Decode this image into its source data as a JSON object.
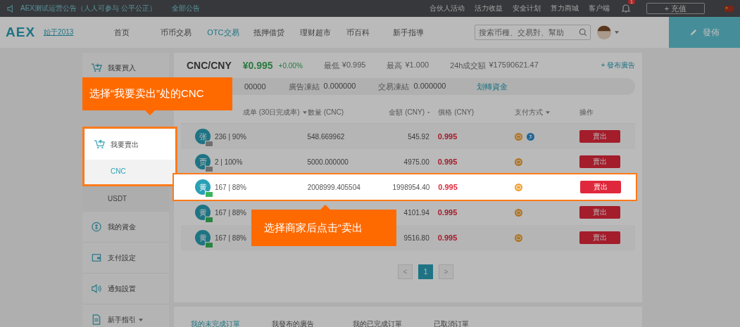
{
  "top_bar": {
    "notice": "AEX测试运营公告（人人可参与 公平公正）",
    "all_notices": "全部公告",
    "links": [
      "合伙人活动",
      "活力收益",
      "安全计划",
      "算力商城",
      "客户端"
    ],
    "notification_count": "1",
    "deposit_button": "+ 充值"
  },
  "nav": {
    "logo": "AEX",
    "slogan": "始于2013",
    "items": [
      {
        "label": "首页",
        "selected": false
      },
      {
        "label": "币币交易",
        "selected": false
      },
      {
        "label": "OTC交易",
        "selected": true
      },
      {
        "label": "抵押借贷",
        "selected": false
      },
      {
        "label": "理财超市",
        "selected": false
      },
      {
        "label": "币百科",
        "selected": false
      },
      {
        "label": "新手指導",
        "selected": false
      }
    ],
    "search": {
      "placeholder": "搜索币種、交易對、幫助"
    },
    "publish_button": "發佈"
  },
  "sidebar": {
    "items": [
      {
        "label": "我要買入",
        "kind": "buy",
        "highlighted": false
      },
      {
        "label": "我要賣出",
        "kind": "sell",
        "highlighted": true,
        "children": [
          {
            "label": "CNC",
            "selected": true
          },
          {
            "label": "USDT",
            "selected": false
          }
        ]
      },
      {
        "label": "我的資金",
        "kind": "funds",
        "highlighted": false
      },
      {
        "label": "支付設定",
        "kind": "payment",
        "highlighted": false
      },
      {
        "label": "通知設置",
        "kind": "notify",
        "highlighted": false
      },
      {
        "label": "新手指引",
        "kind": "guide",
        "highlighted": false,
        "dropdown": true
      }
    ]
  },
  "market": {
    "pair": "CNC/CNY",
    "price": "¥0.995",
    "change": "+0.00%",
    "stats": [
      {
        "label": "最低",
        "value": "¥0.995"
      },
      {
        "label": "最高",
        "value": "¥1.000"
      },
      {
        "label": "24h成交額",
        "value": "¥17590621.47"
      }
    ],
    "publish_ad": "+ 發布廣告",
    "balances": [
      {
        "value": "00000"
      },
      {
        "label": "廣告凍結",
        "value": "0.000000"
      },
      {
        "label": "交易凍結",
        "value": "0.000000"
      }
    ],
    "transfer_link": "划轉資金"
  },
  "table": {
    "columns": [
      {
        "label": "成单 (30日完成率)",
        "sortable": true
      },
      {
        "label": "數量 (CNC)",
        "sortable": false
      },
      {
        "label": "金額 (CNY)",
        "sortable": true
      },
      {
        "label": "價格 (CNY)",
        "sortable": false
      },
      {
        "label": "支付方式",
        "sortable": true
      },
      {
        "label": "操作",
        "sortable": false
      }
    ],
    "rows": [
      {
        "avatar": "张",
        "verified": false,
        "orders": "236 | 90%",
        "quantity": "548.669962",
        "amount": "545.92",
        "price": "0.995",
        "payments": [
          {
            "kind": "bank"
          },
          {
            "kind": "alipay"
          }
        ],
        "action": "賣出",
        "highlighted": false
      },
      {
        "avatar": "贾",
        "verified": false,
        "orders": "2 | 100%",
        "quantity": "5000.000000",
        "amount": "4975.00",
        "price": "0.995",
        "payments": [
          {
            "kind": "bank"
          }
        ],
        "action": "賣出",
        "highlighted": false
      },
      {
        "avatar": "黄",
        "verified": true,
        "orders": "167 | 88%",
        "quantity": "2008999.405504",
        "amount": "1998954.40",
        "price": "0.995",
        "payments": [
          {
            "kind": "bank"
          }
        ],
        "action": "賣出",
        "highlighted": true
      },
      {
        "avatar": "黄",
        "verified": true,
        "orders": "167 | 88%",
        "amount": "4101.94",
        "price": "0.995",
        "payments": [
          {
            "kind": "bank"
          }
        ],
        "action": "賣出",
        "highlighted": false
      },
      {
        "avatar": "黄",
        "verified": true,
        "orders": "167 | 88%",
        "amount": "9516.80",
        "price": "0.995",
        "payments": [
          {
            "kind": "bank"
          }
        ],
        "action": "賣出",
        "highlighted": false
      }
    ]
  },
  "pagination": {
    "prev": "<",
    "pages": [
      {
        "label": "1",
        "selected": true
      }
    ],
    "next": ">"
  },
  "order_tabs": [
    {
      "label": "我的未完成订單",
      "selected": true
    },
    {
      "label": "我發布的廣告",
      "selected": false
    },
    {
      "label": "我的已完成订單",
      "selected": false
    },
    {
      "label": "已取消订單",
      "selected": false
    }
  ],
  "callouts": [
    {
      "text": "选择“我要卖出”处的CNC",
      "pointer_below": true
    },
    {
      "text": "选择商家后点击“卖出",
      "pointer_below": false
    }
  ]
}
